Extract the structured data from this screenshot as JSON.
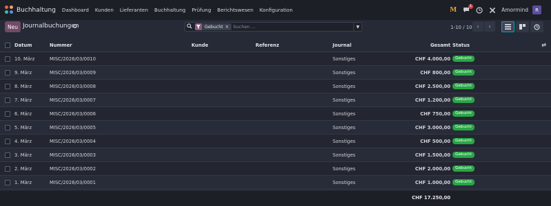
{
  "app": {
    "name": "Buchhaltung"
  },
  "menu": [
    "Dashboard",
    "Kunden",
    "Lieferanten",
    "Buchhaltung",
    "Prüfung",
    "Berichtswesen",
    "Konfiguration"
  ],
  "nav_right": {
    "message_count": "1",
    "company": "Amormind",
    "avatar_initial": "R"
  },
  "control": {
    "new_label": "Neu",
    "title": "Journalbuchungen",
    "facet": "Gebucht",
    "search_placeholder": "Suchen ...",
    "pager": "1-10 / 10"
  },
  "table": {
    "headers": {
      "date": "Datum",
      "number": "Nummer",
      "customer": "Kunde",
      "reference": "Referenz",
      "journal": "Journal",
      "total": "Gesamt",
      "status": "Status"
    },
    "rows": [
      {
        "date": "10. März",
        "number": "MISC/2026/03/0010",
        "customer": "",
        "reference": "",
        "journal": "Sonstiges",
        "total": "CHF 4.000,00",
        "status": "Gebucht"
      },
      {
        "date": "9. März",
        "number": "MISC/2026/03/0009",
        "customer": "",
        "reference": "",
        "journal": "Sonstiges",
        "total": "CHF 800,00",
        "status": "Gebucht"
      },
      {
        "date": "8. März",
        "number": "MISC/2026/03/0008",
        "customer": "",
        "reference": "",
        "journal": "Sonstiges",
        "total": "CHF 2.500,00",
        "status": "Gebucht"
      },
      {
        "date": "7. März",
        "number": "MISC/2026/03/0007",
        "customer": "",
        "reference": "",
        "journal": "Sonstiges",
        "total": "CHF 1.200,00",
        "status": "Gebucht"
      },
      {
        "date": "6. März",
        "number": "MISC/2026/03/0006",
        "customer": "",
        "reference": "",
        "journal": "Sonstiges",
        "total": "CHF 750,00",
        "status": "Gebucht"
      },
      {
        "date": "5. März",
        "number": "MISC/2026/03/0005",
        "customer": "",
        "reference": "",
        "journal": "Sonstiges",
        "total": "CHF 3.000,00",
        "status": "Gebucht"
      },
      {
        "date": "4. März",
        "number": "MISC/2026/03/0004",
        "customer": "",
        "reference": "",
        "journal": "Sonstiges",
        "total": "CHF 500,00",
        "status": "Gebucht"
      },
      {
        "date": "3. März",
        "number": "MISC/2026/03/0003",
        "customer": "",
        "reference": "",
        "journal": "Sonstiges",
        "total": "CHF 1.500,00",
        "status": "Gebucht"
      },
      {
        "date": "2. März",
        "number": "MISC/2026/03/0002",
        "customer": "",
        "reference": "",
        "journal": "Sonstiges",
        "total": "CHF 2.000,00",
        "status": "Gebucht"
      },
      {
        "date": "1. März",
        "number": "MISC/2026/03/0001",
        "customer": "",
        "reference": "",
        "journal": "Sonstiges",
        "total": "CHF 1.000,00",
        "status": "Gebucht"
      }
    ],
    "sum_total": "CHF 17.250,00"
  },
  "colors": {
    "primary": "#714b67",
    "badge_posted": "#28a745",
    "accent": "#0aa3b0"
  }
}
